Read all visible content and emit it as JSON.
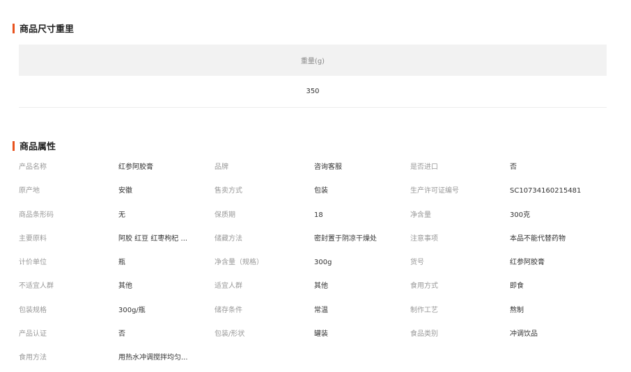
{
  "size_section": {
    "title": "商品尺寸重里",
    "header": "重量(g)",
    "value": "350"
  },
  "attr_section": {
    "title": "商品属性",
    "rows": [
      [
        {
          "label": "产品名称",
          "value": "红参阿胶膏"
        },
        {
          "label": "品牌",
          "value": "咨询客服"
        },
        {
          "label": "是否进口",
          "value": "否"
        }
      ],
      [
        {
          "label": "原产地",
          "value": "安徽"
        },
        {
          "label": "售卖方式",
          "value": "包装"
        },
        {
          "label": "生产许可证编号",
          "value": "SC10734160215481"
        }
      ],
      [
        {
          "label": "商品条形码",
          "value": "无"
        },
        {
          "label": "保质期",
          "value": "18"
        },
        {
          "label": "净含量",
          "value": "300克"
        }
      ],
      [
        {
          "label": "主要原料",
          "value": "阿胶 红豆 红枣枸杞 ..."
        },
        {
          "label": "储藏方法",
          "value": "密封置于阴凉干燥处"
        },
        {
          "label": "注意事项",
          "value": "本品不能代替药物"
        }
      ],
      [
        {
          "label": "计价单位",
          "value": "瓶"
        },
        {
          "label": "净含量（规格）",
          "value": "300g"
        },
        {
          "label": "货号",
          "value": "红参阿胶膏"
        }
      ],
      [
        {
          "label": "不适宜人群",
          "value": "其他"
        },
        {
          "label": "适宜人群",
          "value": "其他"
        },
        {
          "label": "食用方式",
          "value": "即食"
        }
      ],
      [
        {
          "label": "包装规格",
          "value": "300g/瓶"
        },
        {
          "label": "储存条件",
          "value": "常温"
        },
        {
          "label": "制作工艺",
          "value": "熬制"
        }
      ],
      [
        {
          "label": "产品认证",
          "value": "否"
        },
        {
          "label": "包装/形状",
          "value": "罐装"
        },
        {
          "label": "食品类别",
          "value": "冲调饮品"
        }
      ],
      [
        {
          "label": "食用方法",
          "value": "用热水冲调搅拌均匀..."
        }
      ]
    ]
  },
  "colors": {
    "accent": "#e8531f",
    "header_bg": "#f2f2f2",
    "label": "#999999",
    "value": "#333333"
  }
}
